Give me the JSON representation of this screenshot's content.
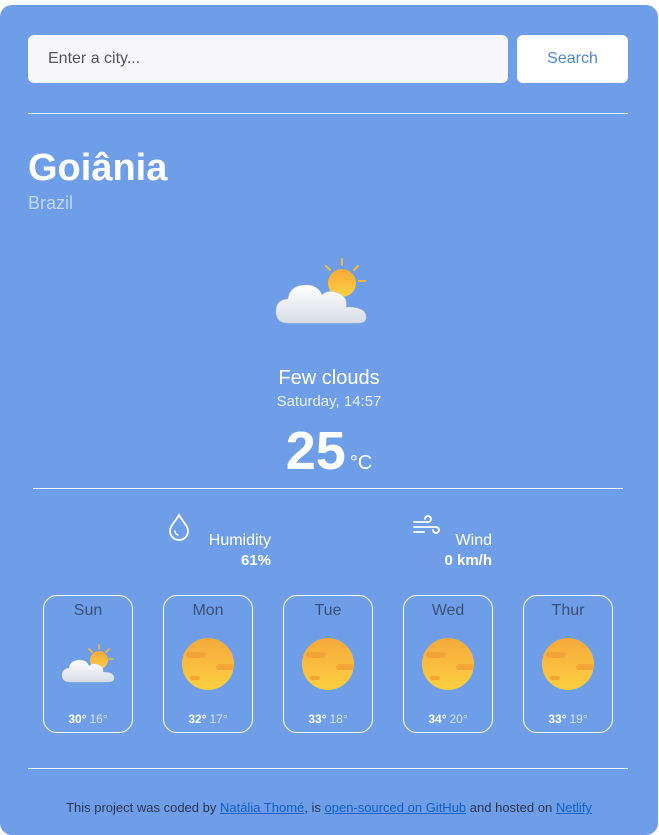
{
  "search": {
    "placeholder": "Enter a city...",
    "button_label": "Search"
  },
  "location": {
    "city": "Goiânia",
    "country": "Brazil"
  },
  "current": {
    "icon": "few-clouds-icon",
    "condition": "Few clouds",
    "datetime": "Saturday, 14:57",
    "temperature": "25",
    "unit": "°C"
  },
  "metrics": {
    "humidity": {
      "icon": "water-drop-icon",
      "label": "Humidity",
      "value": "61%"
    },
    "wind": {
      "icon": "wind-icon",
      "label": "Wind",
      "value": "0 km/h"
    }
  },
  "forecast": [
    {
      "day": "Sun",
      "icon": "few-clouds-icon",
      "max": "30°",
      "min": "16°"
    },
    {
      "day": "Mon",
      "icon": "sun-haze-icon",
      "max": "32°",
      "min": "17°"
    },
    {
      "day": "Tue",
      "icon": "sun-haze-icon",
      "max": "33°",
      "min": "18°"
    },
    {
      "day": "Wed",
      "icon": "sun-haze-icon",
      "max": "34°",
      "min": "20°"
    },
    {
      "day": "Thur",
      "icon": "sun-haze-icon",
      "max": "33°",
      "min": "19°"
    }
  ],
  "footer": {
    "text_1": "This project was coded by ",
    "author_link": "Natália Thomé",
    "text_2": ", is ",
    "github_link": "open-sourced on GitHub",
    "text_3": " and hosted on ",
    "host_link": "Netlify"
  },
  "colors": {
    "background": "#6f9ee9",
    "button_text": "#4f86d9",
    "sun": "#f9b633",
    "link": "#1160c8"
  }
}
